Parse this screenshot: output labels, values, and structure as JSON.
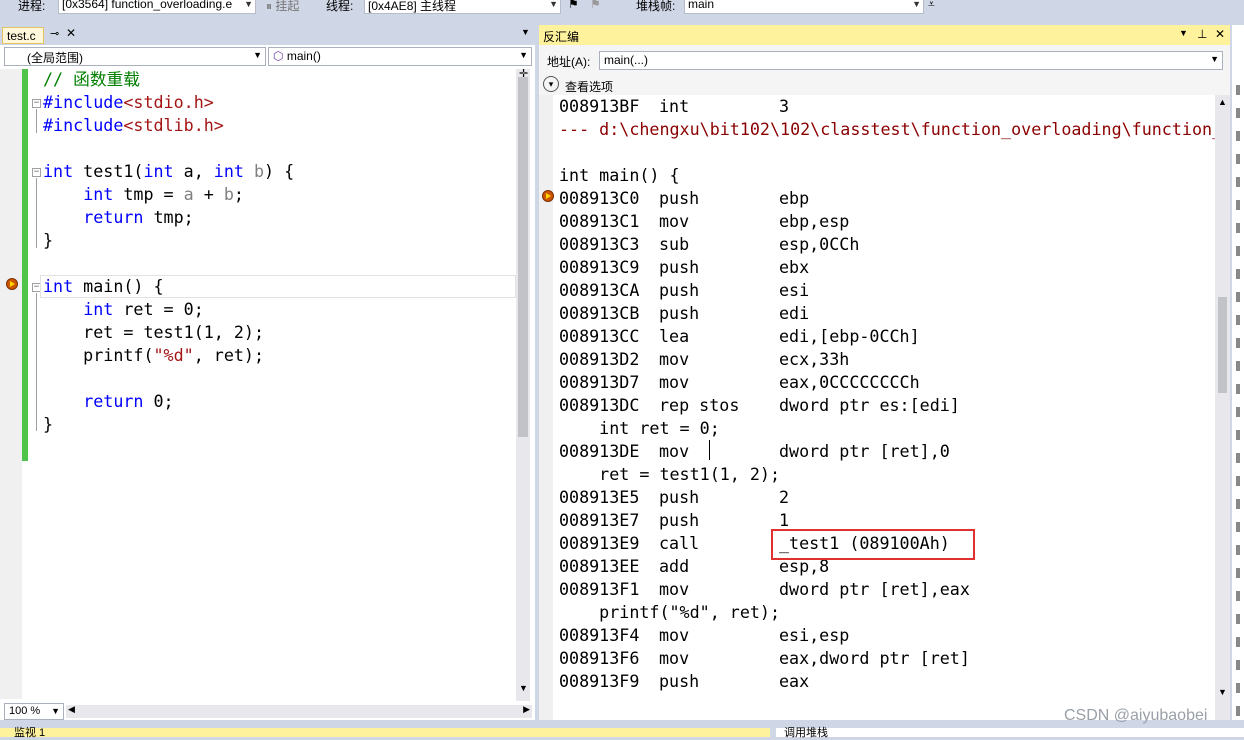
{
  "toolbar": {
    "process_label": "进程:",
    "process_value": "[0x3564] function_overloading.e",
    "suspend_label": "挂起",
    "thread_label": "线程:",
    "thread_value": "[0x4AE8] 主线程",
    "stack_label": "堆栈帧:",
    "stack_value": "main"
  },
  "editor": {
    "tab_label": "test.c",
    "scope_combo": "(全局范围)",
    "function_combo": "main()",
    "zoom": "100 %",
    "lines": [
      "// 函数重载",
      "#include<stdio.h>",
      "#include<stdlib.h>",
      "",
      "int test1(int a, int b) {",
      "    int tmp = a + b;",
      "    return tmp;",
      "}",
      "",
      "int main() {",
      "    int ret = 0;",
      "    ret = test1(1, 2);",
      "    printf(\"%d\", ret);",
      "",
      "    return 0;",
      "}"
    ]
  },
  "disasm": {
    "title": "反汇编",
    "address_label": "地址(A):",
    "address_value": "main(...)",
    "view_options": "查看选项",
    "rows": [
      {
        "addr": "008913BF",
        "op": "int",
        "arg": "3"
      },
      {
        "src": "--- d:\\chengxu\\bit102\\102\\classtest\\function_overloading\\function_"
      },
      {
        "src": ""
      },
      {
        "src": "int main() {"
      },
      {
        "addr": "008913C0",
        "op": "push",
        "arg": "ebp"
      },
      {
        "addr": "008913C1",
        "op": "mov",
        "arg": "ebp,esp"
      },
      {
        "addr": "008913C3",
        "op": "sub",
        "arg": "esp,0CCh"
      },
      {
        "addr": "008913C9",
        "op": "push",
        "arg": "ebx"
      },
      {
        "addr": "008913CA",
        "op": "push",
        "arg": "esi"
      },
      {
        "addr": "008913CB",
        "op": "push",
        "arg": "edi"
      },
      {
        "addr": "008913CC",
        "op": "lea",
        "arg": "edi,[ebp-0CCh]"
      },
      {
        "addr": "008913D2",
        "op": "mov",
        "arg": "ecx,33h"
      },
      {
        "addr": "008913D7",
        "op": "mov",
        "arg": "eax,0CCCCCCCCh"
      },
      {
        "addr": "008913DC",
        "op": "rep stos",
        "arg": "dword ptr es:[edi]"
      },
      {
        "src": "    int ret = 0;"
      },
      {
        "addr": "008913DE",
        "op": "mov",
        "arg": "dword ptr [ret],0"
      },
      {
        "src": "    ret = test1(1, 2);"
      },
      {
        "addr": "008913E5",
        "op": "push",
        "arg": "2"
      },
      {
        "addr": "008913E7",
        "op": "push",
        "arg": "1"
      },
      {
        "addr": "008913E9",
        "op": "call",
        "arg": "_test1 (089100Ah)"
      },
      {
        "addr": "008913EE",
        "op": "add",
        "arg": "esp,8"
      },
      {
        "addr": "008913F1",
        "op": "mov",
        "arg": "dword ptr [ret],eax"
      },
      {
        "src": "    printf(\"%d\", ret);"
      },
      {
        "addr": "008913F4",
        "op": "mov",
        "arg": "esi,esp"
      },
      {
        "addr": "008913F6",
        "op": "mov",
        "arg": "eax,dword ptr [ret]"
      },
      {
        "addr": "008913F9",
        "op": "push",
        "arg": "eax"
      }
    ]
  },
  "bottom": {
    "left_tab": "监视 1",
    "right_tab": "调用堆栈"
  },
  "watermark": "CSDN @aiyubaobei",
  "colors": {
    "keyword": "#0000ff",
    "string": "#a31515",
    "comment": "#008000",
    "highlight_box": "#e03030",
    "source_line": "#8b0000"
  }
}
